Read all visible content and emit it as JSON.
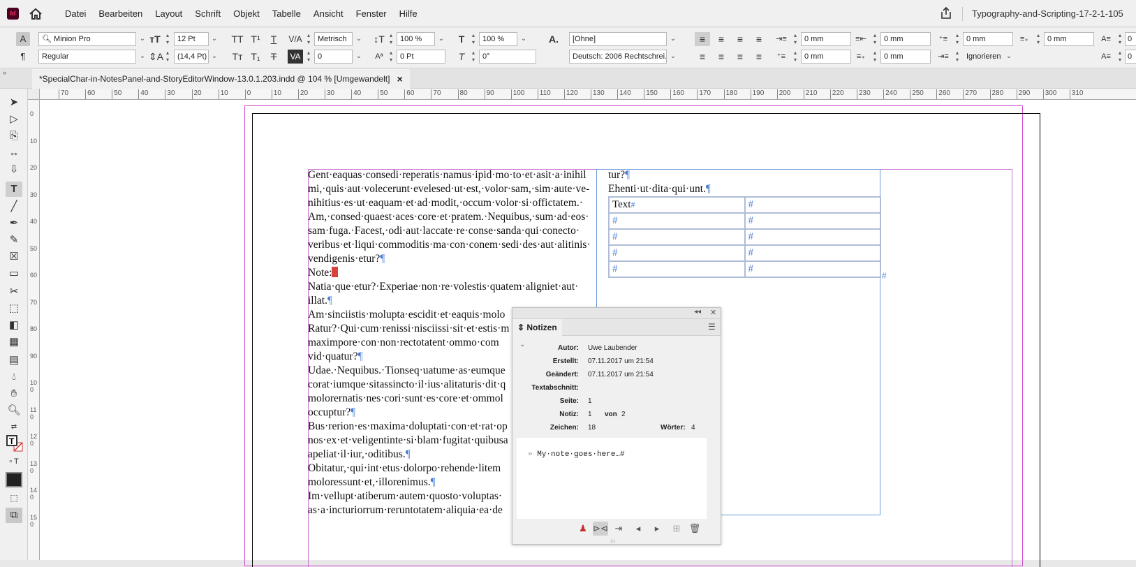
{
  "menubar": {
    "logo": "Id",
    "items": [
      "Datei",
      "Bearbeiten",
      "Layout",
      "Schrift",
      "Objekt",
      "Tabelle",
      "Ansicht",
      "Fenster",
      "Hilfe"
    ],
    "document_name": "Typography-and-Scripting-17-2-1-105"
  },
  "control": {
    "font_family": "Minion Pro",
    "font_style": "Regular",
    "font_size": "12 Pt",
    "leading": "(14,4 Pt)",
    "kerning": "Metrisch",
    "tracking": "0",
    "vertical_scale": "100 %",
    "horizontal_scale": "100 %",
    "baseline_shift": "0 Pt",
    "skew": "0°",
    "char_style": "[Ohne]",
    "language": "Deutsch: 2006 Rechtschrei...",
    "indent_left": "0 mm",
    "indent_right": "0 mm",
    "first_indent": "0 mm",
    "last_indent": "0 mm",
    "space_before": "0 mm",
    "space_after": "0 mm",
    "drop_cap_lines": "0 mm",
    "drop_cap_chars": "0 mm",
    "grid_align": "Ignorieren",
    "overflow_value": "0"
  },
  "tab": {
    "title": "*SpecialChar-in-NotesPanel-and-StoryEditorWindow-13.0.1.203.indd @ 104 % [Umgewandelt]",
    "close": "×"
  },
  "ruler": {
    "h_ticks": [
      "70",
      "60",
      "50",
      "40",
      "30",
      "20",
      "10",
      "0",
      "10",
      "20",
      "30",
      "40",
      "50",
      "60",
      "70",
      "80",
      "90",
      "100",
      "110",
      "120",
      "130",
      "140",
      "150",
      "160",
      "170",
      "180",
      "190",
      "200",
      "210",
      "220",
      "230",
      "240",
      "250",
      "260",
      "270",
      "280",
      "290",
      "300",
      "310"
    ],
    "v_ticks": [
      "0",
      "10",
      "20",
      "30",
      "40",
      "50",
      "60",
      "70",
      "80",
      "90",
      "100",
      "110",
      "120",
      "130",
      "140",
      "150"
    ]
  },
  "story": {
    "col1_lines": [
      "Gent·eaquas·consedi·reperatis·namus·ipid·mo·to·et·asit·a·inihil",
      "mi,·quis·aut·volecerunt·evelesed·ut·est,·volor·sam,·sim·aute·ve-",
      "nihitius·es·ut·eaquam·et·ad·modit,·occum·volor·si·offictatem.·",
      "Am,·consed·quaest·aces·core·et·pratem.·Nequibus,·sum·ad·eos·",
      "sam·fuga.·Facest,·odi·aut·laccate·re·conse·sanda·qui·conecto·",
      "veribus·et·liqui·commoditis·ma·con·conem·sedi·des·aut·alitinis·",
      "vendigenis·etur?",
      "Note:",
      "Natia·que·etur?·Experiae·non·re·volestis·quatem·aligniet·aut·",
      "illat.",
      "Am·sinciistis·molupta·escidit·et·eaquis·molo",
      "Ratur?·Qui·cum·renissi·nisciissi·sit·et·estis·m",
      "maximpore·con·non·rectotatent·ommo·com",
      "vid·quatur?",
      "Udae.·Nequibus.·Tionseq·uatume·as·eumque",
      "corat·iumque·sitassincto·il·ius·alitaturis·dit·q",
      "molorernatis·nes·cori·sunt·es·core·et·ommol",
      "occuptur?",
      "Bus·rerion·es·maxima·doluptati·con·et·rat·op",
      "nos·ex·et·veligentinte·si·blam·fugitat·quibusa",
      "apeliat·il·iur,·oditibus.",
      "Obitatur,·qui·int·etus·dolorpo·rehende·litem",
      "moloressunt·et,·illorenimus.",
      "Im·vellupt·atiberum·autem·quosto·voluptas·",
      "as·a·incturiorrum·reruntotatem·aliquia·ea·de"
    ],
    "col2_lines": [
      "tur?",
      "Ehenti·ut·dita·qui·unt."
    ],
    "pilcrow": "¶",
    "table_cells": [
      [
        "Text",
        "#"
      ],
      [
        "#",
        "#"
      ],
      [
        "#",
        "#"
      ],
      [
        "#",
        "#"
      ],
      [
        "#",
        "#"
      ]
    ],
    "table_end": "#"
  },
  "notes_panel": {
    "tab_label": "Notizen",
    "labels": {
      "author": "Autor:",
      "created": "Erstellt:",
      "modified": "Geändert:",
      "story": "Textabschnitt:",
      "page": "Seite:",
      "note": "Notiz:",
      "of": "von",
      "chars": "Zeichen:",
      "words": "Wörter:"
    },
    "author": "Uwe Laubender",
    "created": "07.11.2017 um 21:54",
    "modified": "07.11.2017 um 21:54",
    "page": "1",
    "note_index": "1",
    "note_total": "2",
    "chars": "18",
    "words": "4",
    "note_text": "My·note·goes·here…#",
    "note_arrow": "»"
  }
}
